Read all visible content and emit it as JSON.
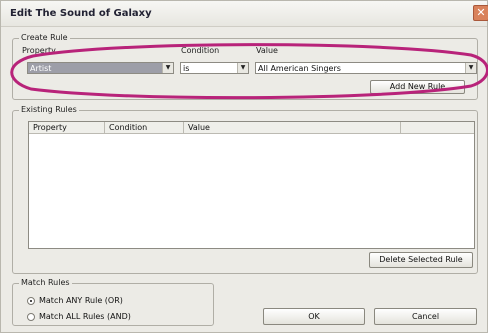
{
  "window": {
    "title": "Edit The Sound of Galaxy",
    "close_symbol": "✕"
  },
  "create_rule": {
    "legend": "Create Rule",
    "property_label": "Property",
    "condition_label": "Condition",
    "value_label": "Value",
    "property_value": "Artist",
    "condition_value": "is",
    "value_value": "All American Singers",
    "add_button": "Add New Rule"
  },
  "existing_rules": {
    "legend": "Existing Rules",
    "columns": [
      "Property",
      "Condition",
      "Value"
    ],
    "rows": [],
    "delete_button": "Delete Selected Rule"
  },
  "match_rules": {
    "legend": "Match Rules",
    "options": [
      {
        "label": "Match ANY Rule (OR)",
        "selected": true
      },
      {
        "label": "Match ALL Rules (AND)",
        "selected": false
      }
    ]
  },
  "footer": {
    "ok": "OK",
    "cancel": "Cancel"
  },
  "annotation": {
    "color": "#b8237a"
  },
  "icons": {
    "dropdown": "chevron-down-icon",
    "close": "close-icon"
  }
}
